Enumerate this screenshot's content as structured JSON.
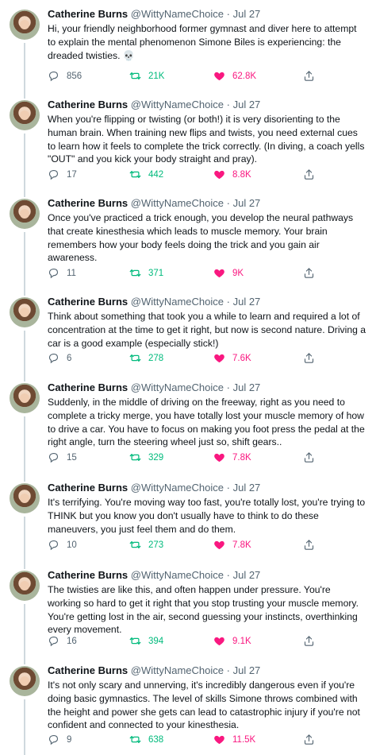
{
  "author": {
    "name": "Catherine Burns",
    "handle": "@WittyNameChoice",
    "separator": "·",
    "date": "Jul 27"
  },
  "colors": {
    "retweet": "#00ba7c",
    "like": "#f91880",
    "muted": "#536471"
  },
  "icons": {
    "reply": "reply-icon",
    "retweet": "retweet-icon",
    "like": "heart-icon",
    "share": "share-icon"
  },
  "tweets": [
    {
      "text": "Hi, your friendly neighborhood former gymnast and diver here to attempt to explain the mental phenomenon Simone Biles is experiencing: the dreaded twisties. 💀",
      "replies": "856",
      "retweets": "21K",
      "likes": "62.8K"
    },
    {
      "text": "When you're flipping or twisting (or both!) it is very disorienting to the human brain. When training new flips and twists, you need external cues to learn how it feels to complete the trick correctly. (In diving, a coach yells \"OUT\" and you kick your body straight and pray).",
      "replies": "17",
      "retweets": "442",
      "likes": "8.8K"
    },
    {
      "text": "Once you've practiced a trick enough, you develop the neural pathways that create kinesthesia which leads to muscle memory. Your brain remembers how your body feels doing the trick and you gain air awareness.",
      "replies": "11",
      "retweets": "371",
      "likes": "9K"
    },
    {
      "text": "Think about something that took you a while to learn and required a lot of concentration at the time to get it right, but now is second nature. Driving a car is a good example (especially stick!)",
      "replies": "6",
      "retweets": "278",
      "likes": "7.6K"
    },
    {
      "text": "Suddenly, in the middle of driving on the freeway, right as you need to complete a tricky merge, you have totally lost your muscle memory of how to drive a car. You have to focus on making you foot press the pedal at the right angle, turn the steering wheel just so, shift gears..",
      "replies": "15",
      "retweets": "329",
      "likes": "7.8K"
    },
    {
      "text": "It's terrifying. You're moving way too fast, you're totally lost, you're trying to THINK but you know you don't usually have to think to do these maneuvers, you just feel them and do them.",
      "replies": "10",
      "retweets": "273",
      "likes": "7.8K"
    },
    {
      "text": "The twisties are like this, and often happen under pressure. You're working so hard to get it right that you stop trusting your muscle memory. You're getting lost in the air, second guessing your instincts, overthinking every movement.",
      "replies": "16",
      "retweets": "394",
      "likes": "9.1K"
    },
    {
      "text": "It's not only scary and unnerving, it's incredibly dangerous even if you're doing basic gymnastics. The level of skills Simone throws combined with the height and power she gets can lead to catastrophic injury if you're not confident and connected to your kinesthesia.",
      "replies": "9",
      "retweets": "638",
      "likes": "11.5K"
    }
  ]
}
